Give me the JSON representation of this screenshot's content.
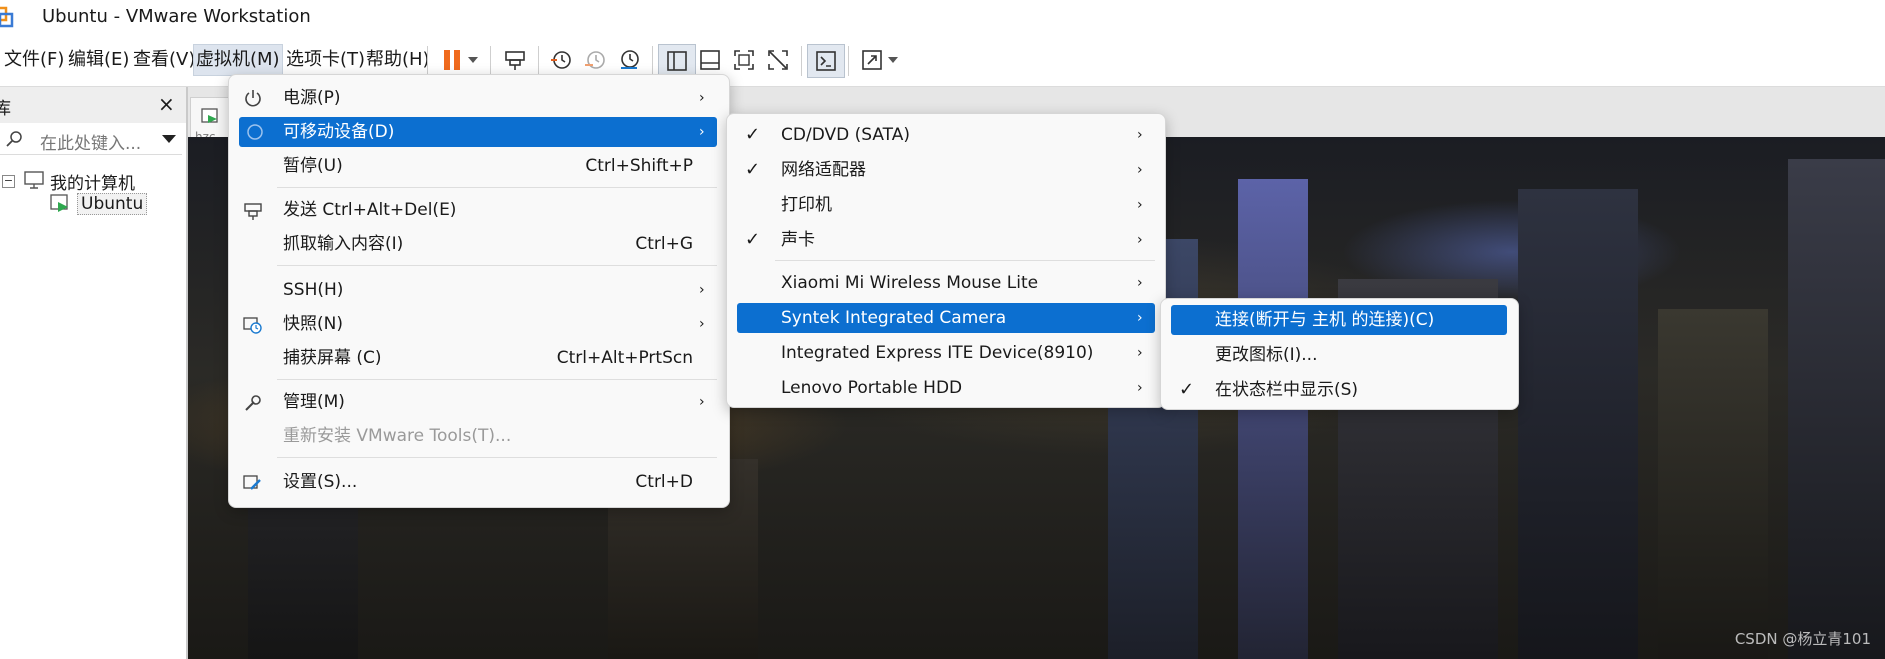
{
  "window": {
    "title": "Ubuntu - VMware Workstation"
  },
  "menubar": [
    {
      "label": "文件(F)"
    },
    {
      "label": "编辑(E)"
    },
    {
      "label": "查看(V)"
    },
    {
      "label": "虚拟机(M)",
      "active": true
    },
    {
      "label": "选项卡(T)"
    },
    {
      "label": "帮助(H)"
    }
  ],
  "toolbar_icons": [
    "pause-icon",
    "dropdown-arrow-icon",
    "send-ctrl-alt-del-icon",
    "snapshot-take-icon",
    "snapshot-revert-icon",
    "snapshot-manager-icon",
    "library-view-icon",
    "thumbnail-bar-icon",
    "fullscreen-icon",
    "unity-disabled-icon",
    "console-view-icon",
    "stretch-icon",
    "dropdown-arrow-icon"
  ],
  "library": {
    "title": "库",
    "search_placeholder": "在此处键入...",
    "tree": {
      "root": "我的计算机",
      "child": "Ubuntu"
    }
  },
  "vm_tab": {
    "label": "hzc"
  },
  "watermark": "CSDN @杨立青101",
  "vm_menu": {
    "items": [
      {
        "label": "电源(P)",
        "submenu": true,
        "icon": "power-icon"
      },
      {
        "label": "可移动设备(D)",
        "submenu": true,
        "icon": "removable-devices-icon",
        "highlighted": true
      },
      {
        "label": "暂停(U)",
        "shortcut": "Ctrl+Shift+P"
      },
      {
        "label": "发送 Ctrl+Alt+Del(E)",
        "icon": "send-keys-icon"
      },
      {
        "label": "抓取输入内容(I)",
        "shortcut": "Ctrl+G"
      },
      {
        "label": "SSH(H)",
        "submenu": true
      },
      {
        "label": "快照(N)",
        "submenu": true,
        "icon": "snapshot-icon"
      },
      {
        "label": "捕获屏幕 (C)",
        "shortcut": "Ctrl+Alt+PrtScn"
      },
      {
        "label": "管理(M)",
        "submenu": true,
        "icon": "wrench-icon"
      },
      {
        "label": "重新安装 VMware Tools(T)...",
        "disabled": true
      },
      {
        "label": "设置(S)...",
        "shortcut": "Ctrl+D",
        "icon": "settings-icon"
      }
    ]
  },
  "devices_menu": {
    "items": [
      {
        "label": "CD/DVD (SATA)",
        "checked": true,
        "submenu": true
      },
      {
        "label": "网络适配器",
        "checked": true,
        "submenu": true
      },
      {
        "label": "打印机",
        "submenu": true
      },
      {
        "label": "声卡",
        "checked": true,
        "submenu": true
      },
      {
        "label": "Xiaomi Mi Wireless Mouse Lite",
        "submenu": true
      },
      {
        "label": "Syntek Integrated Camera",
        "submenu": true,
        "highlighted": true
      },
      {
        "label": "Integrated Express ITE Device(8910)",
        "submenu": true
      },
      {
        "label": "Lenovo Portable HDD",
        "submenu": true
      }
    ]
  },
  "camera_menu": {
    "items": [
      {
        "label": "连接(断开与 主机 的连接)(C)",
        "highlighted": true
      },
      {
        "label": "更改图标(I)..."
      },
      {
        "label": "在状态栏中显示(S)",
        "checked": true
      }
    ]
  },
  "glyphs": {
    "submenu_arrow": "›",
    "check": "✓",
    "close": "×",
    "collapse": "−"
  },
  "colors": {
    "highlight": "#0c6fd0",
    "pause": "#f06a1d"
  }
}
